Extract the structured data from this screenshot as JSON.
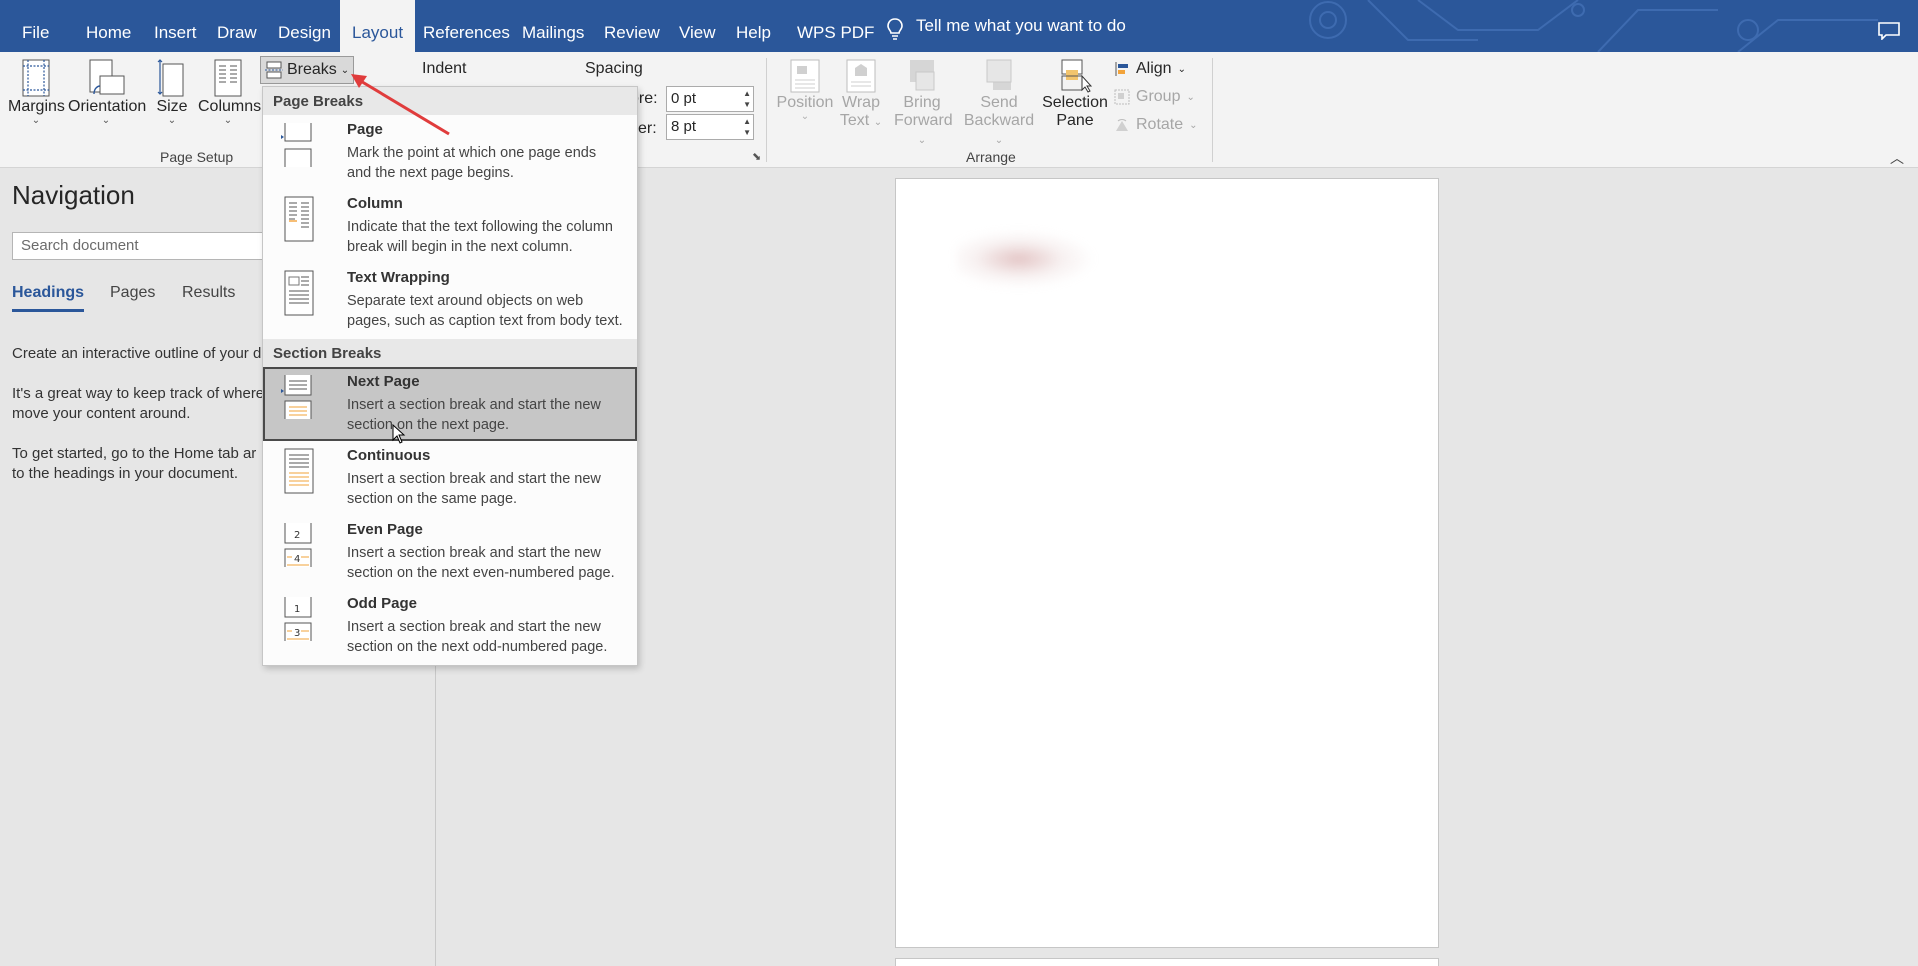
{
  "tabs": {
    "file": "File",
    "home": "Home",
    "insert": "Insert",
    "draw": "Draw",
    "design": "Design",
    "layout": "Layout",
    "references": "References",
    "mailings": "Mailings",
    "review": "Review",
    "view": "View",
    "help": "Help",
    "wps_pdf": "WPS PDF",
    "tell_me": "Tell me what you want to do"
  },
  "ribbon": {
    "page_setup": {
      "margins": "Margins",
      "orientation": "Orientation",
      "size": "Size",
      "columns": "Columns",
      "breaks": "Breaks",
      "group_label": "Page Setup"
    },
    "paragraph": {
      "indent": "Indent",
      "spacing": "Spacing",
      "before_label": "ore:",
      "before_value": "0 pt",
      "after_label": "er:",
      "after_value": "8 pt"
    },
    "arrange": {
      "position_1": "Position",
      "wrap_1": "Wrap",
      "wrap_2": "Text",
      "bring_1": "Bring",
      "bring_2": "Forward",
      "send_1": "Send",
      "send_2": "Backward",
      "selection_1": "Selection",
      "selection_2": "Pane",
      "align": "Align",
      "group": "Group",
      "rotate": "Rotate",
      "group_label": "Arrange"
    }
  },
  "navigation": {
    "title": "Navigation",
    "search_placeholder": "Search document",
    "tabs": [
      "Headings",
      "Pages",
      "Results"
    ],
    "text_1": "Create an interactive outline of your d",
    "text_2a": "It's a great way to keep track of where",
    "text_2b": "move your content around.",
    "text_3a": "To get started, go to the Home tab ar",
    "text_3b": "to the headings in your document."
  },
  "breaks_menu": {
    "page_breaks_header": "Page Breaks",
    "section_breaks_header": "Section Breaks",
    "items": [
      {
        "title": "Page",
        "desc_1": "Mark the point at which one page ends",
        "desc_2": "and the next page begins."
      },
      {
        "title": "Column",
        "desc_1": "Indicate that the text following the column",
        "desc_2": "break will begin in the next column."
      },
      {
        "title": "Text Wrapping",
        "desc_1": "Separate text around objects on web",
        "desc_2": "pages, such as caption text from body text."
      },
      {
        "title": "Next Page",
        "desc_1": "Insert a section break and start the new",
        "desc_2": "section on the next page."
      },
      {
        "title": "Continuous",
        "desc_1": "Insert a section break and start the new",
        "desc_2": "section on the same page."
      },
      {
        "title": "Even Page",
        "desc_1": "Insert a section break and start the new",
        "desc_2": "section on the next even-numbered page."
      },
      {
        "title": "Odd Page",
        "desc_1": "Insert a section break and start the new",
        "desc_2": "section on the next odd-numbered page."
      }
    ]
  },
  "colors": {
    "accent": "#2b579a",
    "annotation_arrow": "#e03c3c",
    "highlight": "#c6c6c6"
  }
}
